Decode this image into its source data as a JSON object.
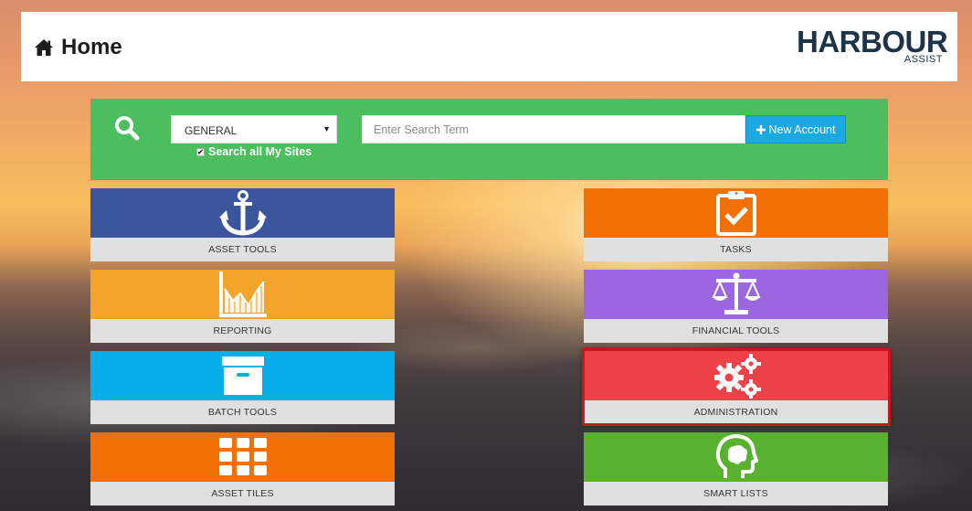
{
  "header": {
    "title": "Home",
    "logo_main": "HARBOUR",
    "logo_sub": "ASSIST"
  },
  "search": {
    "category_value": "GENERAL",
    "input_placeholder": "Enter Search Term",
    "search_all_label": "Search all My Sites",
    "search_all_checked": true,
    "new_account_label": "New Account"
  },
  "tiles": [
    {
      "label": "ASSET TOOLS",
      "color": "#3a559b",
      "icon": "anchor-icon"
    },
    {
      "label": "TASKS",
      "color": "#f37004",
      "icon": "clipboard-check-icon"
    },
    {
      "label": "REPORTING",
      "color": "#f5a42b",
      "icon": "area-chart-icon"
    },
    {
      "label": "FINANCIAL TOOLS",
      "color": "#9b67e0",
      "icon": "balance-scale-icon"
    },
    {
      "label": "BATCH TOOLS",
      "color": "#08aee9",
      "icon": "archive-box-icon"
    },
    {
      "label": "ADMINISTRATION",
      "color": "#ee4148",
      "icon": "gears-icon",
      "highlighted": true
    },
    {
      "label": "ASSET TILES",
      "color": "#f37004",
      "icon": "grid-icon"
    },
    {
      "label": "SMART LISTS",
      "color": "#58b22f",
      "icon": "head-brain-icon"
    }
  ],
  "colors": {
    "header_bg": "#ffffff",
    "search_panel": "#4cbe5f",
    "new_account_button": "#1ca9e1",
    "highlight_border": "#c8161c",
    "tile_label_bg": "#e0e0e0",
    "logo": "#1f3346"
  }
}
